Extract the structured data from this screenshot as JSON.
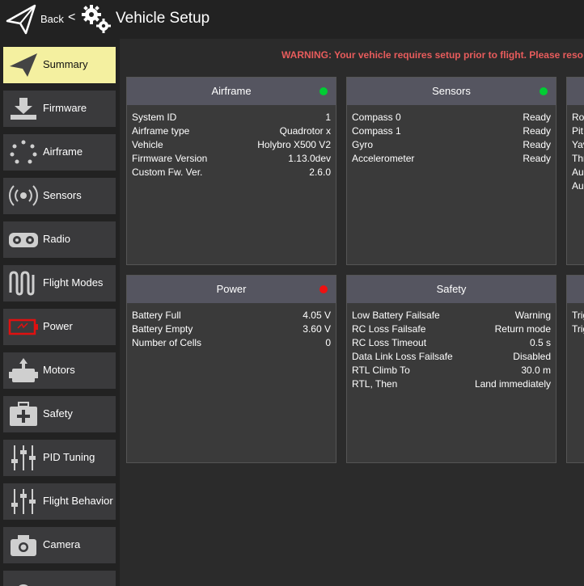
{
  "header": {
    "back_label": "Back",
    "chevron": "<",
    "title": "Vehicle Setup",
    "logo_icon": "paper-plane-icon",
    "gears_icon": "gears-icon"
  },
  "sidebar": {
    "items": [
      {
        "label": "Summary",
        "icon": "paper-plane-icon",
        "active": true
      },
      {
        "label": "Firmware",
        "icon": "download-icon"
      },
      {
        "label": "Airframe",
        "icon": "airframe-icon"
      },
      {
        "label": "Sensors",
        "icon": "radio-waves-icon"
      },
      {
        "label": "Radio",
        "icon": "radio-controller-icon"
      },
      {
        "label": "Flight Modes",
        "icon": "wave-icon"
      },
      {
        "label": "Power",
        "icon": "battery-icon"
      },
      {
        "label": "Motors",
        "icon": "motor-icon"
      },
      {
        "label": "Safety",
        "icon": "first-aid-icon"
      },
      {
        "label": "PID Tuning",
        "icon": "sliders-icon"
      },
      {
        "label": "Flight Behavior",
        "icon": "sliders-icon"
      },
      {
        "label": "Camera",
        "icon": "camera-icon"
      }
    ]
  },
  "main": {
    "warning": "WARNING: Your vehicle requires setup prior to flight. Please reso",
    "cards": {
      "airframe": {
        "title": "Airframe",
        "status_color": "#00cc33",
        "rows": [
          {
            "k": "System ID",
            "v": "1"
          },
          {
            "k": "Airframe type",
            "v": "Quadrotor x"
          },
          {
            "k": "Vehicle",
            "v": "Holybro X500 V2"
          },
          {
            "k": "Firmware Version",
            "v": "1.13.0dev"
          },
          {
            "k": "Custom Fw. Ver.",
            "v": "2.6.0"
          }
        ]
      },
      "sensors": {
        "title": "Sensors",
        "status_color": "#00cc33",
        "rows": [
          {
            "k": "Compass 0",
            "v": "Ready"
          },
          {
            "k": "Compass 1",
            "v": "Ready"
          },
          {
            "k": "Gyro",
            "v": "Ready"
          },
          {
            "k": "Accelerometer",
            "v": "Ready"
          }
        ]
      },
      "radio_partial": {
        "rows": [
          "Rol",
          "Pit",
          "Yav",
          "Thr",
          "Au",
          "Au"
        ]
      },
      "power": {
        "title": "Power",
        "status_color": "#ee1111",
        "rows": [
          {
            "k": "Battery Full",
            "v": "4.05 V"
          },
          {
            "k": "Battery Empty",
            "v": "3.60 V"
          },
          {
            "k": "Number of Cells",
            "v": "0"
          }
        ]
      },
      "safety": {
        "title": "Safety",
        "rows": [
          {
            "k": "Low Battery Failsafe",
            "v": "Warning"
          },
          {
            "k": "RC Loss Failsafe",
            "v": "Return mode"
          },
          {
            "k": "RC Loss Timeout",
            "v": "0.5 s"
          },
          {
            "k": "Data Link Loss Failsafe",
            "v": "Disabled"
          },
          {
            "k": "RTL Climb To",
            "v": "30.0 m"
          },
          {
            "k": "RTL, Then",
            "v": "Land immediately"
          }
        ]
      },
      "camera_partial": {
        "rows": [
          "Trig",
          "Trig"
        ]
      }
    }
  }
}
